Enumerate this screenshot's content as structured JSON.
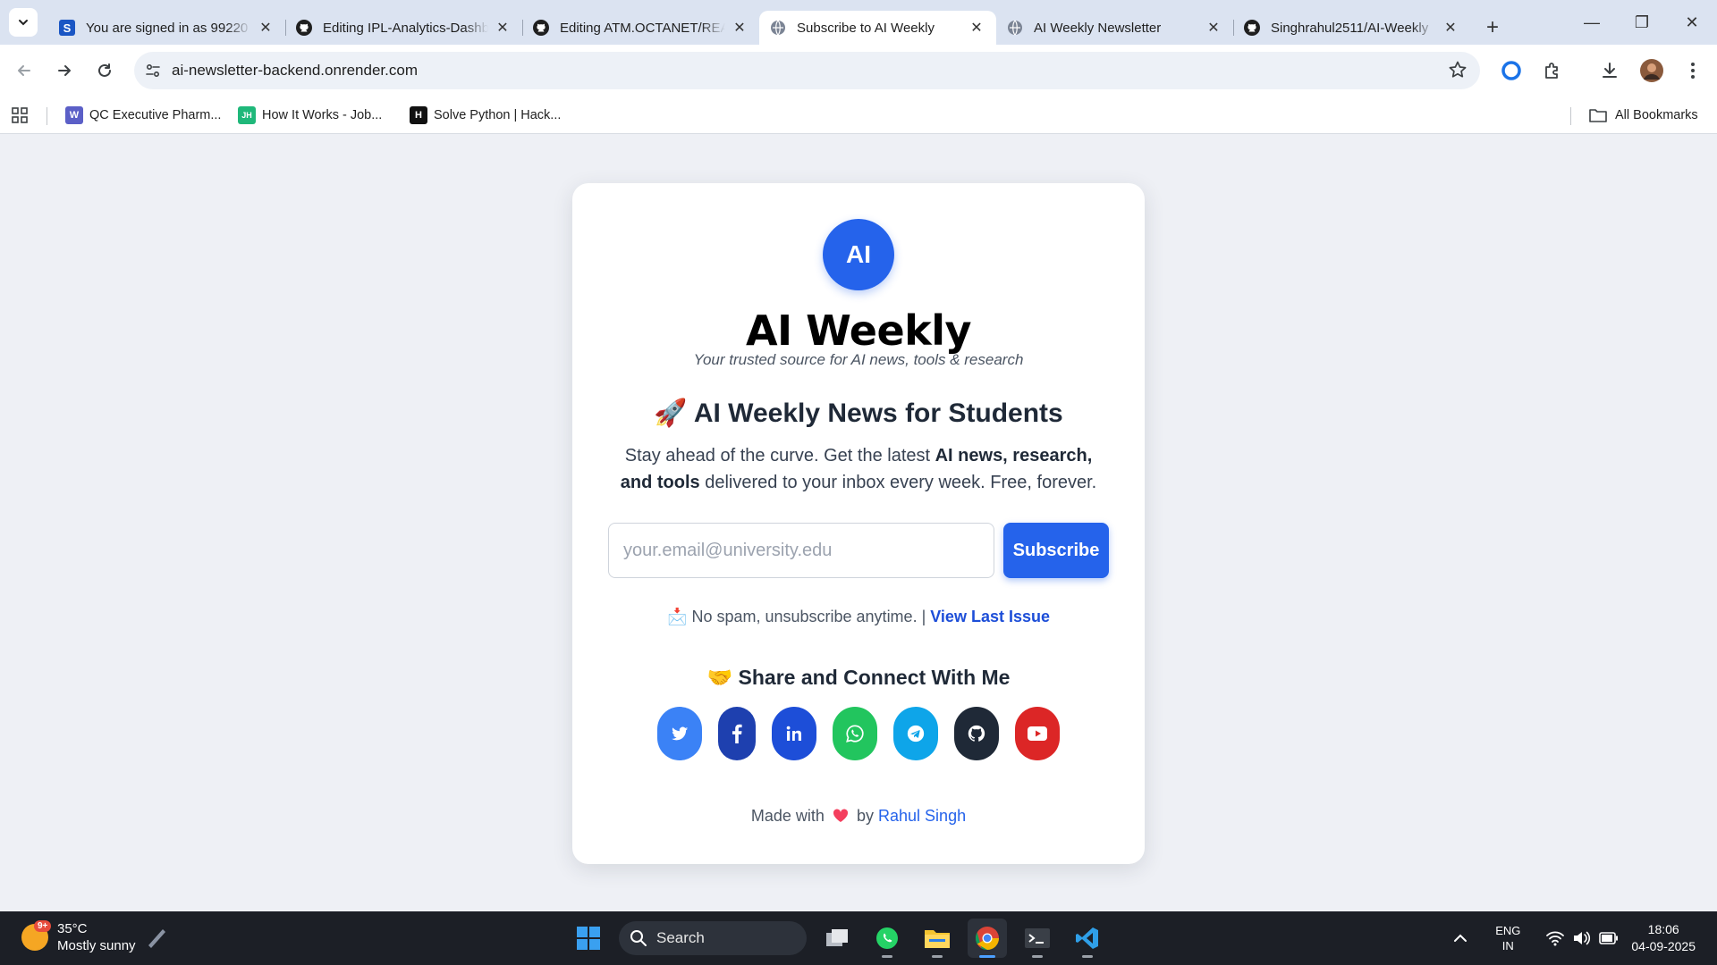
{
  "browser": {
    "tabs": [
      {
        "title": "You are signed in as 99220",
        "favicon": "s-icon",
        "active": false
      },
      {
        "title": "Editing IPL-Analytics-Dashb",
        "favicon": "github-icon",
        "active": false
      },
      {
        "title": "Editing ATM.OCTANET/REA",
        "favicon": "github-icon",
        "active": false
      },
      {
        "title": "Subscribe to AI Weekly",
        "favicon": "globe-icon",
        "active": true
      },
      {
        "title": "AI Weekly Newsletter",
        "favicon": "globe-icon",
        "active": false
      },
      {
        "title": "Singhrahul2511/AI-Weekly",
        "favicon": "github-icon",
        "active": false
      }
    ],
    "url": "ai-newsletter-backend.onrender.com",
    "bookmarks": [
      {
        "label": "QC Executive Pharm...",
        "icon": "W",
        "color": "#5b5fc7"
      },
      {
        "label": "How It Works - Job...",
        "icon": "JH",
        "color": "#1fb87a"
      },
      {
        "label": "Solve Python | Hack...",
        "icon": "H",
        "color": "#111111"
      }
    ],
    "all_bookmarks": "All Bookmarks"
  },
  "page": {
    "logo": "AI",
    "brand": "AI Weekly",
    "tagline": "Your trusted source for AI news, tools & research",
    "headline_emoji": "🚀",
    "headline": "AI Weekly News for Students",
    "desc_pre": "Stay ahead of the curve. Get the latest ",
    "desc_bold": "AI news, research, and tools",
    "desc_post": " delivered to your inbox every week. Free, forever.",
    "email_placeholder": "your.email@university.edu",
    "subscribe_label": "Subscribe",
    "nospam_emoji": "📩",
    "nospam": "No spam, unsubscribe anytime. | ",
    "view_last": "View Last Issue",
    "share_emoji": "🤝",
    "share_title": "Share and Connect With Me",
    "socials": [
      {
        "name": "twitter",
        "color": "#3b82f6"
      },
      {
        "name": "facebook",
        "color": "#1e40af"
      },
      {
        "name": "linkedin",
        "color": "#1d4ed8"
      },
      {
        "name": "whatsapp",
        "color": "#22c55e"
      },
      {
        "name": "telegram",
        "color": "#0ea5e9"
      },
      {
        "name": "github",
        "color": "#1f2937"
      },
      {
        "name": "youtube",
        "color": "#dc2626"
      }
    ],
    "footer_pre": "Made with",
    "footer_by": "by",
    "footer_author": "Rahul Singh"
  },
  "taskbar": {
    "weather_badge": "9+",
    "temp": "35°C",
    "condition": "Mostly sunny",
    "search": "Search",
    "lang_line1": "ENG",
    "lang_line2": "IN",
    "time": "18:06",
    "date": "04-09-2025"
  }
}
